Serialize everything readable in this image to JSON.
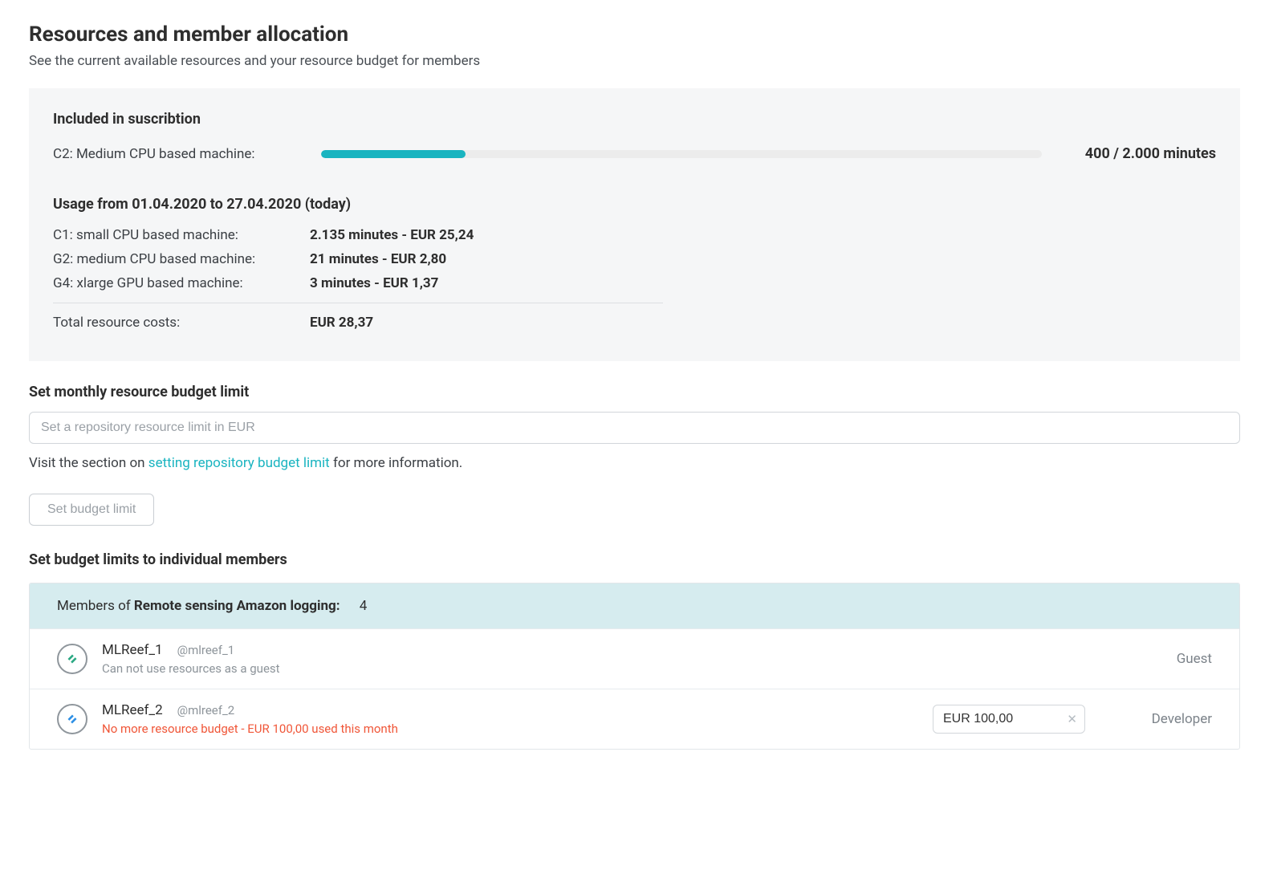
{
  "header": {
    "title": "Resources and member allocation",
    "subtitle": "See the current available resources and your resource budget for members"
  },
  "subscription": {
    "heading": "Included in suscribtion",
    "machine_label": "C2: Medium CPU based machine:",
    "used_display": "400 / 2.000 minutes",
    "progress_percent": 20
  },
  "usage": {
    "heading": "Usage from 01.04.2020 to 27.04.2020 (today)",
    "rows": [
      {
        "label": "C1: small CPU based machine:",
        "value": "2.135 minutes - EUR 25,24"
      },
      {
        "label": "G2: medium CPU based machine:",
        "value": "21 minutes - EUR 2,80"
      },
      {
        "label": "G4: xlarge GPU based machine:",
        "value": "3 minutes - EUR 1,37"
      }
    ],
    "total_label": "Total resource costs:",
    "total_value": "EUR 28,37"
  },
  "budget": {
    "heading": "Set monthly resource budget limit",
    "input_placeholder": "Set a repository resource limit in EUR",
    "helper_prefix": "Visit the section on ",
    "helper_link": "setting repository budget limit",
    "helper_suffix": " for more information.",
    "button_label": "Set budget limit"
  },
  "members_section": {
    "heading": "Set budget limits to individual members",
    "header_prefix": "Members of ",
    "header_project": "Remote sensing Amazon logging:",
    "count": "4",
    "members": [
      {
        "name": "MLReef_1",
        "handle": "@mlreef_1",
        "note": "Can not use resources as a guest",
        "note_warn": false,
        "budget_value": "",
        "role": "Guest",
        "avatar_color": "#2aa882"
      },
      {
        "name": "MLReef_2",
        "handle": "@mlreef_2",
        "note": "No more resource budget - EUR 100,00 used this month",
        "note_warn": true,
        "budget_value": "EUR 100,00",
        "role": "Developer",
        "avatar_color": "#2d8fe5"
      }
    ]
  }
}
